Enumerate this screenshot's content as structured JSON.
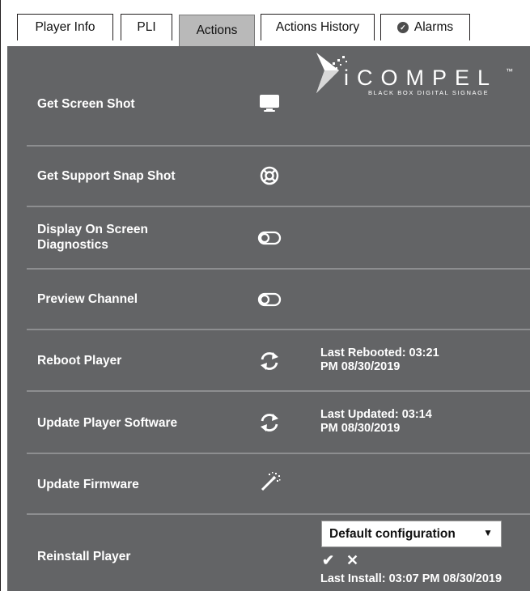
{
  "tabs": [
    {
      "label": "Player Info"
    },
    {
      "label": "PLI"
    },
    {
      "label": "Actions"
    },
    {
      "label": "Actions History"
    },
    {
      "label": "Alarms",
      "icon": "check-circle-icon"
    }
  ],
  "active_tab": "Actions",
  "logo": {
    "name": "iCOMPEL",
    "tm": "™",
    "tagline": "BLACK BOX DIGITAL SIGNAGE"
  },
  "actions": [
    {
      "label": "Get Screen Shot",
      "icon": "monitor-icon"
    },
    {
      "label": "Get Support Snap Shot",
      "icon": "lifebuoy-icon"
    },
    {
      "label": "Display On Screen Diagnostics",
      "icon": "toggle-off-icon"
    },
    {
      "label": "Preview Channel",
      "icon": "toggle-off-icon"
    },
    {
      "label": "Reboot Player",
      "icon": "refresh-icon",
      "info_line1": "Last Rebooted: 03:21",
      "info_line2": "PM 08/30/2019"
    },
    {
      "label": "Update Player Software",
      "icon": "refresh-icon",
      "info_line1": "Last Updated: 03:14",
      "info_line2": "PM 08/30/2019"
    },
    {
      "label": "Update Firmware",
      "icon": "magic-wand-icon"
    },
    {
      "label": "Reinstall Player"
    }
  ],
  "reinstall": {
    "selected": "Default configuration",
    "caret": "▼",
    "confirm_glyph": "✔",
    "cancel_glyph": "✕",
    "last_install": "Last Install: 03:07 PM 08/30/2019"
  },
  "colors": {
    "panel": "#636466",
    "divider": "#8d8e90",
    "active_tab": "#b9b9b9",
    "text": "#ffffff"
  }
}
